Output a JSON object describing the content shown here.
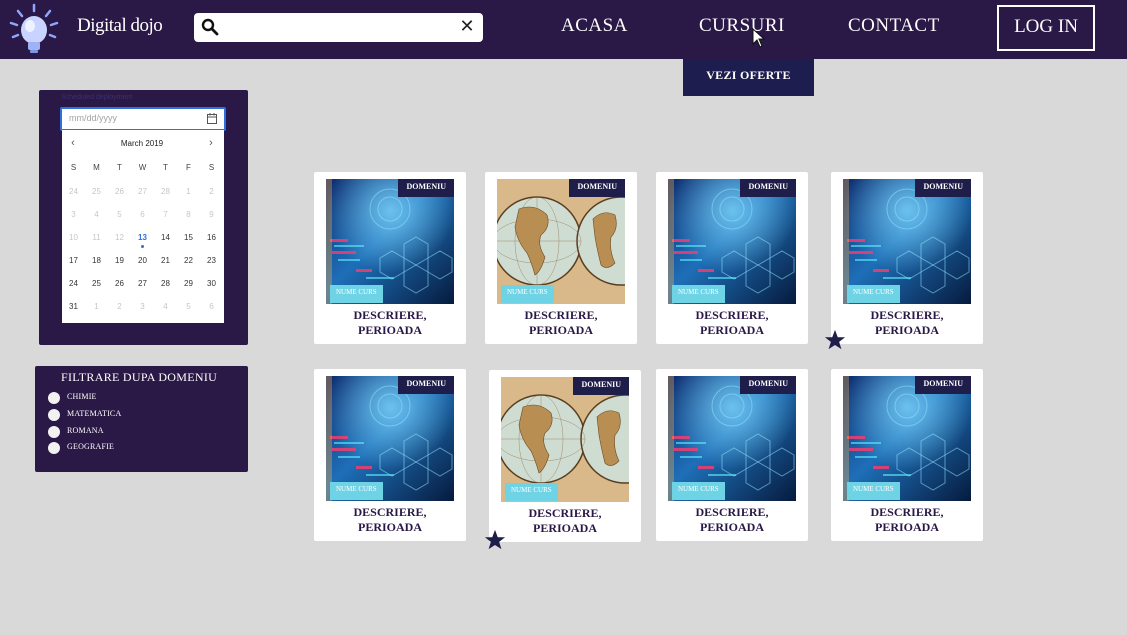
{
  "header": {
    "logo_text": "Digital dojo",
    "search_placeholder": "",
    "search_clear": "✕",
    "nav": [
      "ACASA",
      "CURSURI",
      "CONTACT"
    ],
    "login_label": "LOG IN",
    "dropdown_label": "VEZI OFERTE"
  },
  "date_picker": {
    "label": "Scheduled deployment",
    "placeholder": "mm/dd/yyyy",
    "month_title": "March  2019",
    "weekdays": [
      "S",
      "M",
      "T",
      "W",
      "T",
      "F",
      "S"
    ],
    "weeks": [
      [
        "24",
        "25",
        "26",
        "27",
        "28",
        "1",
        "2"
      ],
      [
        "3",
        "4",
        "5",
        "6",
        "7",
        "8",
        "9"
      ],
      [
        "10",
        "11",
        "12",
        "13",
        "14",
        "15",
        "16"
      ],
      [
        "17",
        "18",
        "19",
        "20",
        "21",
        "22",
        "23"
      ],
      [
        "24",
        "25",
        "26",
        "27",
        "28",
        "29",
        "30"
      ],
      [
        "31",
        "1",
        "2",
        "3",
        "4",
        "5",
        "6"
      ]
    ],
    "today": "13"
  },
  "filter": {
    "title": "FILTRARE DUPA DOMENIU",
    "items": [
      "CHIMIE",
      "MATEMATICA",
      "ROMANA",
      "GEOGRAFIE"
    ]
  },
  "cards": [
    {
      "domain": "DOMENIU",
      "course": "NUME CURS",
      "desc_line1": "DESCRIERE,",
      "desc_line2": "PERIOADA",
      "image": "tech-image",
      "favorite": false
    },
    {
      "domain": "DOMENIU",
      "course": "NUME CURS",
      "desc_line1": "DESCRIERE,",
      "desc_line2": "PERIOADA",
      "image": "map-image",
      "favorite": false
    },
    {
      "domain": "DOMENIU",
      "course": "NUME CURS",
      "desc_line1": "DESCRIERE,",
      "desc_line2": "PERIOADA",
      "image": "tech-image",
      "favorite": false
    },
    {
      "domain": "DOMENIU",
      "course": "NUME CURS",
      "desc_line1": "DESCRIERE,",
      "desc_line2": "PERIOADA",
      "image": "tech-image",
      "favorite": true
    },
    {
      "domain": "DOMENIU",
      "course": "NUME CURS",
      "desc_line1": "DESCRIERE,",
      "desc_line2": "PERIOADA",
      "image": "tech-image",
      "favorite": false
    },
    {
      "domain": "DOMENIU",
      "course": "NUME CURS",
      "desc_line1": "DESCRIERE,",
      "desc_line2": "PERIOADA",
      "image": "map-image",
      "favorite": true
    },
    {
      "domain": "DOMENIU",
      "course": "NUME CURS",
      "desc_line1": "DESCRIERE,",
      "desc_line2": "PERIOADA",
      "image": "tech-image",
      "favorite": false
    },
    {
      "domain": "DOMENIU",
      "course": "NUME CURS",
      "desc_line1": "DESCRIERE,",
      "desc_line2": "PERIOADA",
      "image": "tech-image",
      "favorite": false
    }
  ],
  "colors": {
    "header_bg": "#2a1846",
    "page_bg": "#d9d9d9",
    "accent_blue": "#2f6fe0",
    "course_tag": "#6fd3e6",
    "domain_tag": "#1f1d4a"
  }
}
